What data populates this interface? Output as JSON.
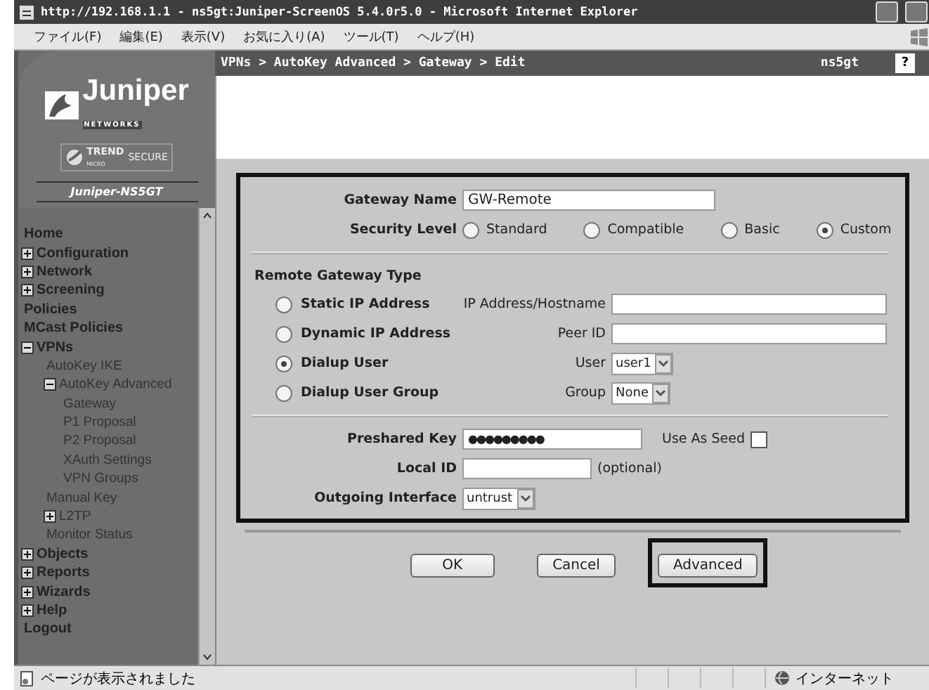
{
  "window": {
    "title": "http://192.168.1.1 - ns5gt:Juniper-ScreenOS 5.4.0r5.0 - Microsoft Internet Explorer"
  },
  "menu": [
    "ファイル(F)",
    "編集(E)",
    "表示(V)",
    "お気に入り(A)",
    "ツール(T)",
    "ヘルプ(H)"
  ],
  "header": {
    "breadcrumb": "VPNs > AutoKey Advanced > Gateway > Edit",
    "device": "ns5gt",
    "help": "?"
  },
  "sidebar": {
    "logo": "Juniper",
    "logo_sub": "NETWORKS",
    "partner": "TREND",
    "partner_sub": "MICRO",
    "partner_tag": "SECURE",
    "device": "Juniper-NS5GT",
    "items": [
      {
        "label": "Home",
        "kind": "page"
      },
      {
        "label": "Configuration",
        "kind": "folder",
        "expanded": false
      },
      {
        "label": "Network",
        "kind": "folder",
        "expanded": false
      },
      {
        "label": "Screening",
        "kind": "folder",
        "expanded": false
      },
      {
        "label": "Policies",
        "kind": "page"
      },
      {
        "label": "MCast Policies",
        "kind": "page"
      },
      {
        "label": "VPNs",
        "kind": "folder",
        "expanded": true,
        "children": [
          {
            "label": "AutoKey IKE",
            "kind": "page"
          },
          {
            "label": "AutoKey Advanced",
            "kind": "folder",
            "expanded": true,
            "children": [
              {
                "label": "Gateway",
                "kind": "page"
              },
              {
                "label": "P1 Proposal",
                "kind": "page"
              },
              {
                "label": "P2 Proposal",
                "kind": "page"
              },
              {
                "label": "XAuth Settings",
                "kind": "page"
              },
              {
                "label": "VPN Groups",
                "kind": "page"
              }
            ]
          },
          {
            "label": "Manual Key",
            "kind": "page"
          },
          {
            "label": "L2TP",
            "kind": "folder",
            "expanded": false
          },
          {
            "label": "Monitor Status",
            "kind": "page"
          }
        ]
      },
      {
        "label": "Objects",
        "kind": "folder",
        "expanded": false
      },
      {
        "label": "Reports",
        "kind": "folder",
        "expanded": false
      },
      {
        "label": "Wizards",
        "kind": "folder",
        "expanded": false
      },
      {
        "label": "Help",
        "kind": "folder",
        "expanded": false
      },
      {
        "label": "Logout",
        "kind": "page"
      }
    ]
  },
  "form": {
    "gateway_name": {
      "label": "Gateway Name",
      "value": "GW-Remote"
    },
    "security_level": {
      "label": "Security Level",
      "options": [
        {
          "label": "Standard",
          "selected": false
        },
        {
          "label": "Compatible",
          "selected": false
        },
        {
          "label": "Basic",
          "selected": false
        },
        {
          "label": "Custom",
          "selected": true
        }
      ]
    },
    "remote_gateway_type": {
      "title": "Remote Gateway Type",
      "options": [
        {
          "label": "Static IP Address",
          "selected": false,
          "field_label": "IP Address/Hostname",
          "kind": "text"
        },
        {
          "label": "Dynamic IP Address",
          "selected": false,
          "field_label": "Peer ID",
          "kind": "text"
        },
        {
          "label": "Dialup User",
          "selected": true,
          "field_label": "User",
          "kind": "select",
          "value": "user1"
        },
        {
          "label": "Dialup User Group",
          "selected": false,
          "field_label": "Group",
          "kind": "select",
          "value": "None"
        }
      ]
    },
    "preshared_key": {
      "label": "Preshared Key",
      "value": "●●●●●●●●●",
      "seed_label": "Use As Seed",
      "seed_checked": false
    },
    "local_id": {
      "label": "Local ID",
      "note": "(optional)"
    },
    "outgoing_interface": {
      "label": "Outgoing Interface",
      "value": "untrust"
    }
  },
  "buttons": [
    {
      "label": "OK",
      "highlighted": false
    },
    {
      "label": "Cancel",
      "highlighted": false
    },
    {
      "label": "Advanced",
      "highlighted": true
    }
  ],
  "status_bar": {
    "text": "ページが表示されました",
    "zone": "インターネット"
  }
}
